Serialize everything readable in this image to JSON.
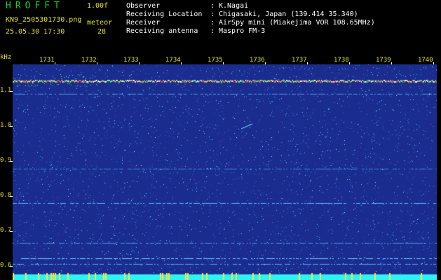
{
  "header": {
    "app_title": "HROFFT",
    "version": "1.00f",
    "filename": "KN9_2505301730.png",
    "date_time": "25.05.30 17:30",
    "meteor_label": "meteor",
    "meteor_count": "28",
    "info": [
      {
        "key": "Observer",
        "value": "K.Nagai"
      },
      {
        "key": "Receiving Location",
        "value": "Chigasaki, Japan (139.414 35.340)"
      },
      {
        "key": "Receiver",
        "value": "AirSpy mini (Miakejima VOR 108.65MHz)"
      },
      {
        "key": "Receiving antenna",
        "value": "Maspro FM-3"
      }
    ]
  },
  "axes": {
    "freq_unit": "kHz",
    "time_ticks": [
      "1731",
      "1732",
      "1733",
      "1734",
      "1735",
      "1736",
      "1737",
      "1738",
      "1739",
      "1740"
    ],
    "freq_ticks": [
      "1.1",
      "1.0",
      "0.9",
      "0.8",
      "0.7",
      "0.6"
    ]
  },
  "colors": {
    "background": "#000000",
    "noise_floor": "#1a2d8f",
    "carrier": "#ff4a4a",
    "axis_text": "#e9e21e",
    "title_green": "#19d11e",
    "bottom_band": "#2ff2f2"
  }
}
